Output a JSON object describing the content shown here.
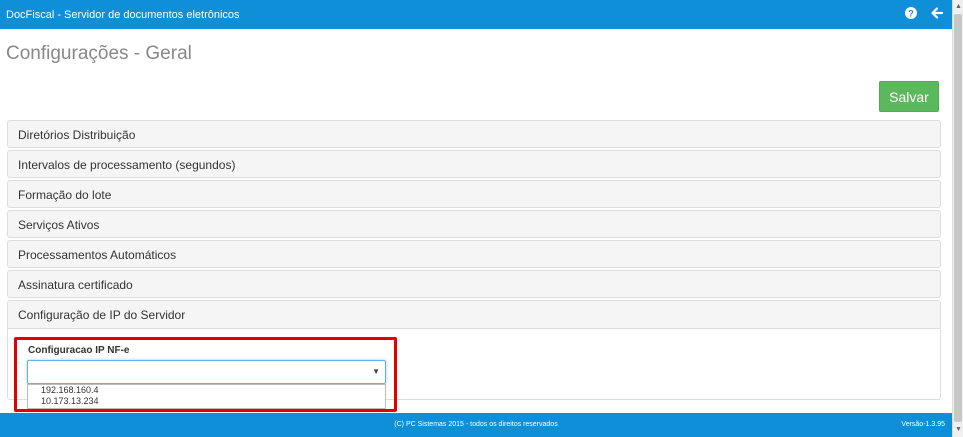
{
  "header": {
    "app_title": "DocFiscal - Servidor de documentos eletrônicos",
    "icons": [
      "help-icon",
      "back-arrow-icon"
    ]
  },
  "page": {
    "title": "Configurações - Geral",
    "save_label": "Salvar",
    "save_color": "#5cb85c"
  },
  "panels": [
    {
      "label": "Diretórios Distribuição",
      "expanded": false
    },
    {
      "label": "Intervalos de processamento (segundos)",
      "expanded": false
    },
    {
      "label": "Formação do lote",
      "expanded": false
    },
    {
      "label": "Serviços Ativos",
      "expanded": false
    },
    {
      "label": "Processamentos Automáticos",
      "expanded": false
    },
    {
      "label": "Assinatura certificado",
      "expanded": false
    },
    {
      "label": "Configuração de IP do Servidor",
      "expanded": true
    }
  ],
  "ip_config": {
    "field_label": "Configuracao IP NF-e",
    "selected_value": "",
    "options": [
      "192.168.160.4",
      "10.173.13.234"
    ]
  },
  "footer": {
    "copyright": "(C) PC Sistemas 2015 - todos os direitos reservados",
    "version": "Versão-1.3.95"
  },
  "colors": {
    "topbar": "#0e8fd8",
    "highlight_border": "#e30000"
  }
}
